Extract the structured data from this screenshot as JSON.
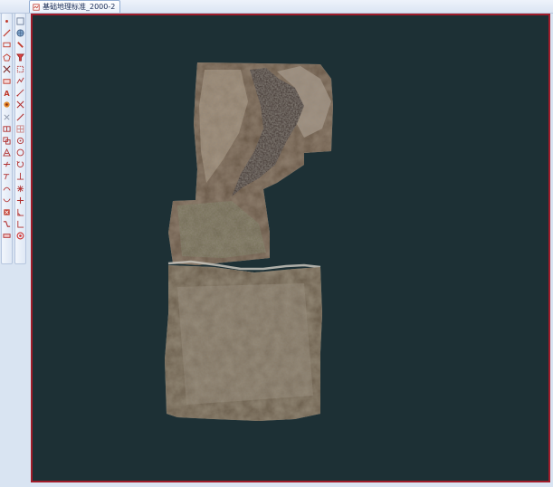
{
  "document_tab": {
    "title": "基础地理标准_2000-2",
    "icon": "map-document-icon"
  },
  "toolbars": {
    "left": [
      "point-icon",
      "line-icon",
      "rectangle-icon",
      "polygon-icon",
      "node-icon",
      "text-edit-icon",
      "text-icon",
      "attribute-icon",
      "scissors-icon",
      "split-icon",
      "copy-icon",
      "symbol-icon",
      "cut-line-icon",
      "extend-icon",
      "arc-icon",
      "curve-icon",
      "delete-icon",
      "snap-icon",
      "ruler-icon"
    ],
    "right": [
      "select-icon",
      "globe-icon",
      "link-icon",
      "filter-icon",
      "box-select-icon",
      "polyline-icon",
      "segment-icon",
      "cross-icon",
      "diagonal-line-icon",
      "grid-icon",
      "circle-icon",
      "ring-icon",
      "rotate-icon",
      "perpendicular-icon",
      "star-icon",
      "plus-icon",
      "angle-icon",
      "corner-icon",
      "target-icon"
    ]
  },
  "canvas": {
    "background_color": "#1d3035",
    "border_color": "#a01c2a",
    "content": "aerial-imagery-mosaic"
  }
}
